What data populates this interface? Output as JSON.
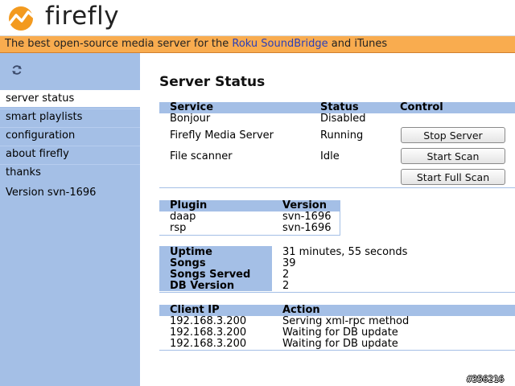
{
  "header": {
    "logo_text": "firefly"
  },
  "tagline": {
    "prefix": "The best open-source media server for the ",
    "link": "Roku SoundBridge",
    "suffix": " and iTunes"
  },
  "sidebar": {
    "refresh_icon": "refresh-icon",
    "items": [
      {
        "label": "server status",
        "active": true
      },
      {
        "label": "smart playlists",
        "active": false
      },
      {
        "label": "configuration",
        "active": false
      },
      {
        "label": "about firefly",
        "active": false
      },
      {
        "label": "thanks",
        "active": false
      }
    ],
    "version": "Version svn-1696"
  },
  "main": {
    "title": "Server Status",
    "services": {
      "headers": [
        "Service",
        "Status",
        "Control"
      ],
      "rows": [
        {
          "service": "Bonjour",
          "status": "Disabled",
          "control": ""
        },
        {
          "service": "Firefly Media Server",
          "status": "Running",
          "control": "Stop Server"
        },
        {
          "service": "File scanner",
          "status": "Idle",
          "control": "Start Scan"
        }
      ],
      "extra_button": "Start Full Scan"
    },
    "plugins": {
      "headers": [
        "Plugin",
        "Version"
      ],
      "rows": [
        {
          "plugin": "daap",
          "version": "svn-1696"
        },
        {
          "plugin": "rsp",
          "version": "svn-1696"
        }
      ]
    },
    "stats": [
      {
        "label": "Uptime",
        "value": "31 minutes, 55 seconds"
      },
      {
        "label": "Songs",
        "value": "39"
      },
      {
        "label": "Songs Served",
        "value": "2"
      },
      {
        "label": "DB Version",
        "value": "2"
      }
    ],
    "clients": {
      "headers": [
        "Client IP",
        "Action"
      ],
      "rows": [
        {
          "ip": "192.168.3.200",
          "action": "Serving xml-rpc method"
        },
        {
          "ip": "192.168.3.200",
          "action": "Waiting for DB update"
        },
        {
          "ip": "192.168.3.200",
          "action": "Waiting for DB update"
        }
      ]
    }
  },
  "watermark": "#356216",
  "colors": {
    "accent_orange": "#f9ac4f",
    "sidebar_blue": "#a4bfe6",
    "link_blue": "#2a3fb8"
  }
}
